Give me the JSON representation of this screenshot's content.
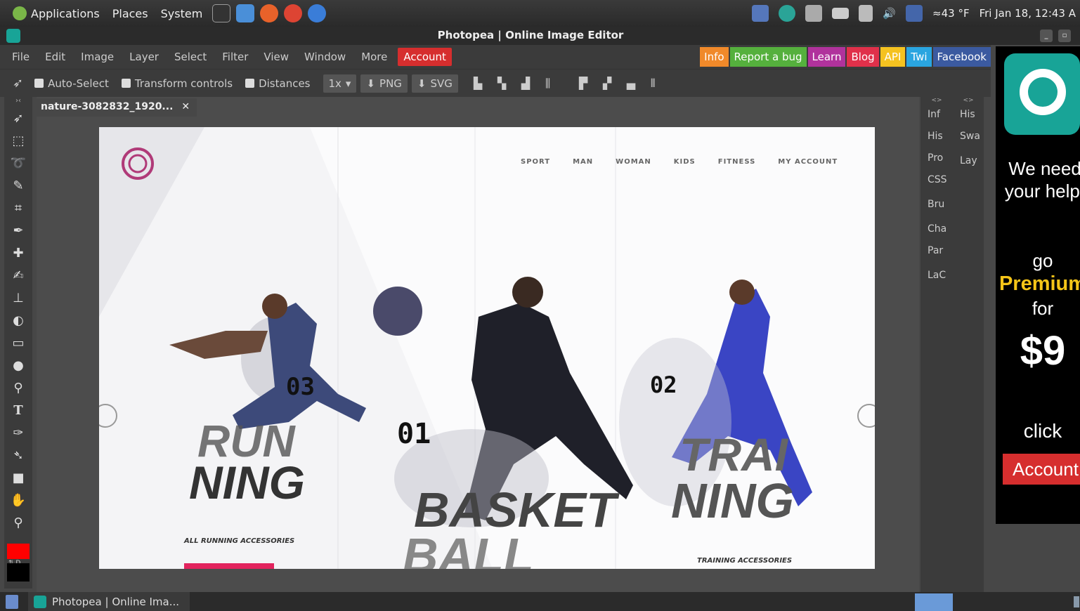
{
  "system_panel": {
    "menus": [
      "Applications",
      "Places",
      "System"
    ],
    "weather": "43 °F",
    "clock": "Fri Jan 18, 12:43 A"
  },
  "window": {
    "title": "Photopea | Online Image Editor"
  },
  "menubar": {
    "items": [
      "File",
      "Edit",
      "Image",
      "Layer",
      "Select",
      "Filter",
      "View",
      "Window",
      "More"
    ],
    "account": "Account",
    "links": [
      {
        "label": "Info",
        "color": "#f0892a"
      },
      {
        "label": "Report a bug",
        "color": "#55b03d"
      },
      {
        "label": "Learn",
        "color": "#b0329c"
      },
      {
        "label": "Blog",
        "color": "#e0304a"
      },
      {
        "label": "API",
        "color": "#f5c220"
      },
      {
        "label": "Twi",
        "color": "#2aa5e0"
      },
      {
        "label": "Facebook",
        "color": "#3b5aa0"
      }
    ]
  },
  "options": {
    "auto_select": "Auto-Select",
    "transform_controls": "Transform controls",
    "distances": "Distances",
    "zoom": "1x",
    "png": "PNG",
    "svg": "SVG"
  },
  "document": {
    "tab_name": "nature-3082832_1920...",
    "close": "✕"
  },
  "canvas_content": {
    "nav": [
      "SPORT",
      "MAN",
      "WOMAN",
      "KIDS",
      "FITNESS",
      "MY ACCOUNT"
    ],
    "num_left": "03",
    "num_center": "01",
    "num_right": "02",
    "word_left_1": "RUN",
    "word_left_2": "NING",
    "word_center_1": "BASKET",
    "word_center_2": "BALL",
    "word_right_1": "TRAI",
    "word_right_2": "NING",
    "caption_left": "ALL RUNNING ACCESSORIES",
    "caption_right": "TRAINING ACCESSORIES"
  },
  "panels": {
    "left": [
      "Inf",
      "His",
      "Pro",
      "CSS",
      "Bru",
      "Cha",
      "Par",
      "LaC"
    ],
    "right": [
      "His",
      "Swa",
      "Lay"
    ],
    "collapse": "<>"
  },
  "ad": {
    "line1": "We need",
    "line2": "your help!",
    "go": "go",
    "premium": "Premium",
    "for": "for",
    "price": "$9",
    "click": "click",
    "account": "Account"
  },
  "taskbar": {
    "window_label": "Photopea | Online Ima..."
  }
}
